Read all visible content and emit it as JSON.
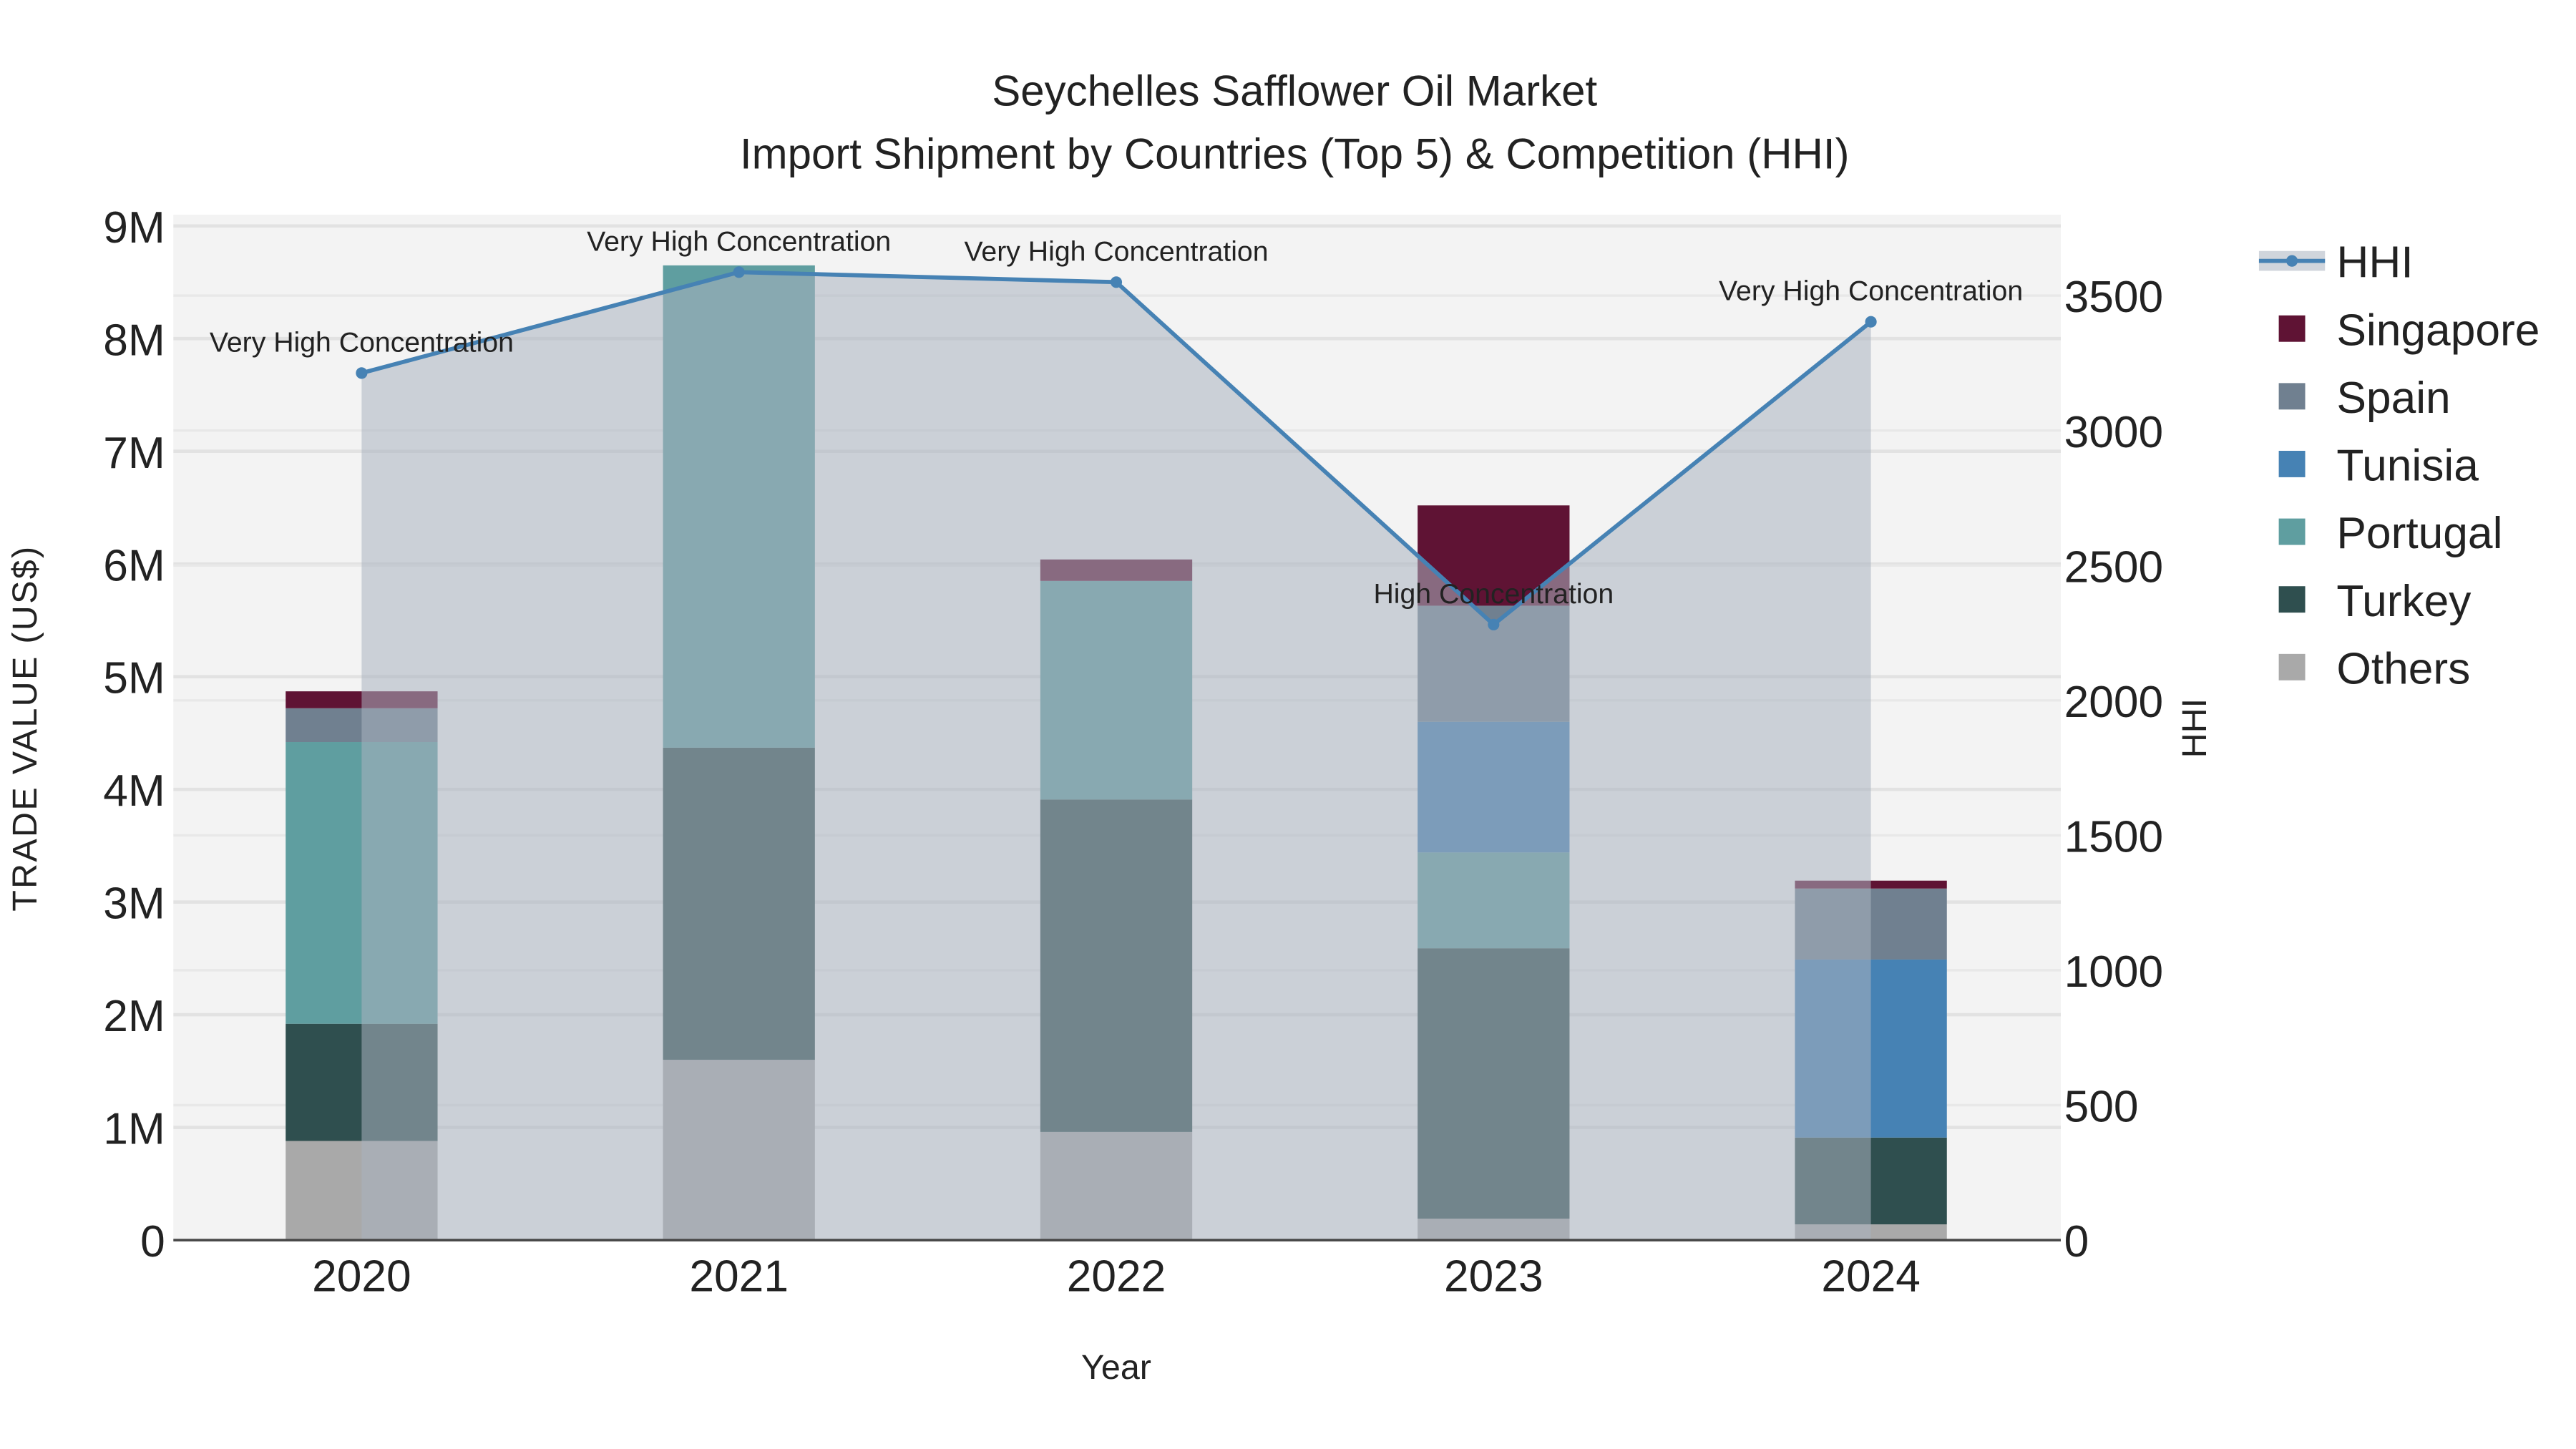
{
  "chart_data": {
    "type": "bar",
    "title": "Seychelles Safflower Oil Market",
    "subtitle": "Import Shipment by Countries (Top 5) & Competition (HHI)",
    "xlabel": "Year",
    "ylabel": "TRADE VALUE (US$)",
    "y2label": "HHI",
    "categories": [
      "2020",
      "2021",
      "2022",
      "2023",
      "2024"
    ],
    "ylim": [
      0,
      9100000
    ],
    "y2lim": [
      0,
      3800
    ],
    "yticks": [
      {
        "v": 0,
        "label": "0"
      },
      {
        "v": 1000000,
        "label": "1M"
      },
      {
        "v": 2000000,
        "label": "2M"
      },
      {
        "v": 3000000,
        "label": "3M"
      },
      {
        "v": 4000000,
        "label": "4M"
      },
      {
        "v": 5000000,
        "label": "5M"
      },
      {
        "v": 6000000,
        "label": "6M"
      },
      {
        "v": 7000000,
        "label": "7M"
      },
      {
        "v": 8000000,
        "label": "8M"
      },
      {
        "v": 9000000,
        "label": "9M"
      }
    ],
    "y2ticks": [
      {
        "v": 0,
        "label": "0"
      },
      {
        "v": 500,
        "label": "500"
      },
      {
        "v": 1000,
        "label": "1000"
      },
      {
        "v": 1500,
        "label": "1500"
      },
      {
        "v": 2000,
        "label": "2000"
      },
      {
        "v": 2500,
        "label": "2500"
      },
      {
        "v": 3000,
        "label": "3000"
      },
      {
        "v": 3500,
        "label": "3500"
      }
    ],
    "series": [
      {
        "name": "Others",
        "color": "#a9a9a9",
        "values": [
          880000,
          1600000,
          960000,
          190000,
          140000
        ]
      },
      {
        "name": "Turkey",
        "color": "#2f4f4f",
        "values": [
          1040000,
          2770000,
          2950000,
          2400000,
          770000
        ]
      },
      {
        "name": "Portugal",
        "color": "#5f9ea0",
        "values": [
          2500000,
          4280000,
          1940000,
          850000,
          0
        ]
      },
      {
        "name": "Tunisia",
        "color": "#4682b4",
        "values": [
          0,
          0,
          0,
          1160000,
          1580000
        ]
      },
      {
        "name": "Spain",
        "color": "#708090",
        "values": [
          300000,
          0,
          0,
          1030000,
          630000
        ]
      },
      {
        "name": "Singapore",
        "color": "#5f1334",
        "values": [
          150000,
          0,
          190000,
          890000,
          70000
        ]
      }
    ],
    "hhi": {
      "name": "HHI",
      "color": "#4682b4",
      "values": [
        3213,
        3587,
        3550,
        2281,
        3403
      ],
      "annotations": [
        "Very High Concentration",
        "Very High Concentration",
        "Very High Concentration",
        "High Concentration",
        "Very High Concentration"
      ]
    },
    "legend_order": [
      "HHI",
      "Singapore",
      "Spain",
      "Tunisia",
      "Portugal",
      "Turkey",
      "Others"
    ],
    "legend_position": "right",
    "grid": true
  }
}
